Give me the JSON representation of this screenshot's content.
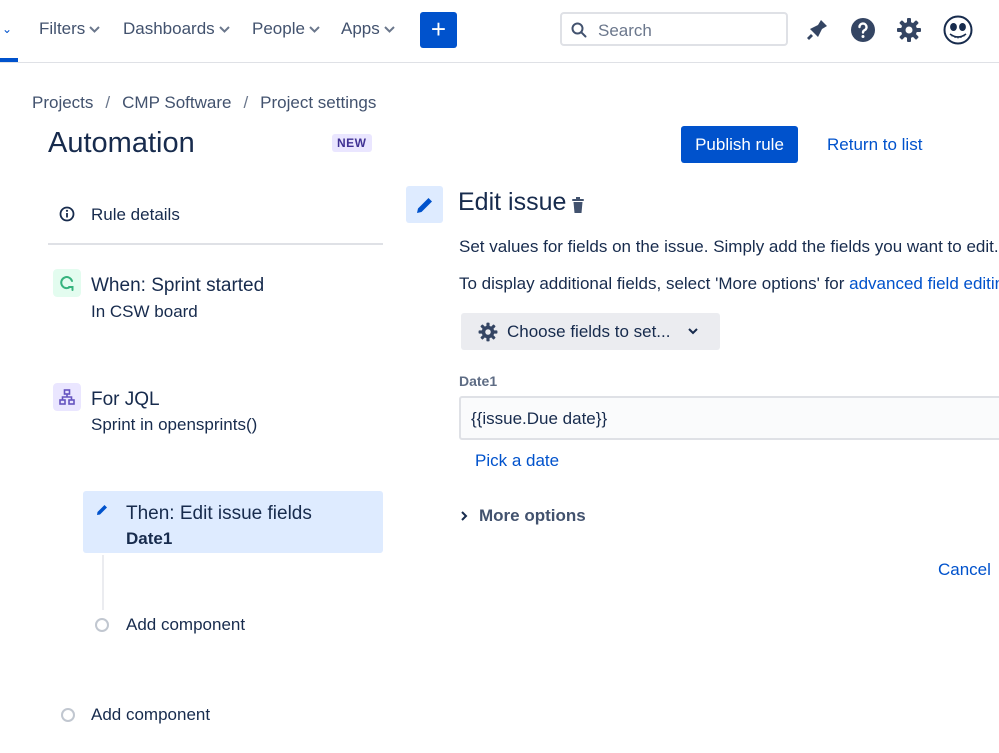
{
  "nav": {
    "items": [
      "Filters",
      "Dashboards",
      "People",
      "Apps"
    ],
    "create_label": "+",
    "search_placeholder": "Search"
  },
  "breadcrumb": [
    "Projects",
    "CMP Software",
    "Project settings"
  ],
  "page": {
    "title": "Automation",
    "badge": "NEW",
    "publish_label": "Publish rule",
    "return_label": "Return to list"
  },
  "rule": {
    "details_label": "Rule details",
    "trigger": {
      "title": "When: Sprint started",
      "subtitle": "In CSW board"
    },
    "condition": {
      "title": "For JQL",
      "subtitle": "Sprint in opensprints()"
    },
    "action": {
      "title": "Then: Edit issue fields",
      "subtitle": "Date1"
    },
    "add_component_inner": "Add component",
    "add_component_outer": "Add component"
  },
  "editor": {
    "title": "Edit issue",
    "description": "Set values for fields on the issue. Simply add the fields you want to edit.",
    "hint_prefix": "To display additional fields, select 'More options' for ",
    "hint_link": "advanced field editing",
    "choose_fields_label": "Choose fields to set...",
    "field_label": "Date1",
    "field_value": "{{issue.Due date}}",
    "pick_date_label": "Pick a date",
    "more_options_label": "More options",
    "cancel_label": "Cancel"
  },
  "colors": {
    "primary": "#0052cc",
    "selected_bg": "#deebff",
    "trigger_green": "#36b37e",
    "condition_purple": "#6554c0"
  }
}
